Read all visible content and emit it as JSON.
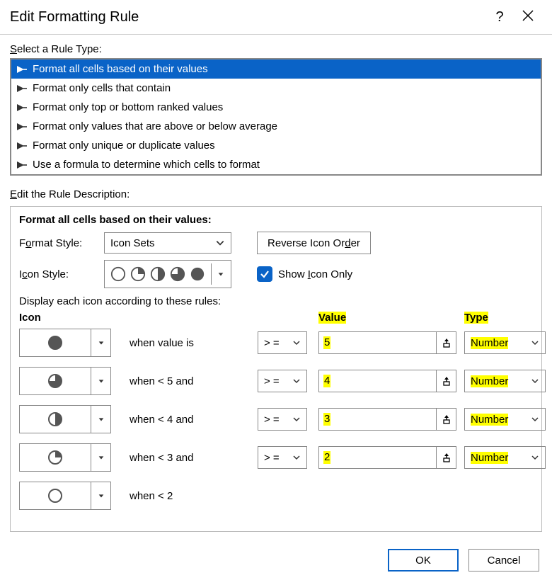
{
  "title": "Edit Formatting Rule",
  "select_label": "Select a Rule Type:",
  "rule_types": [
    "Format all cells based on their values",
    "Format only cells that contain",
    "Format only top or bottom ranked values",
    "Format only values that are above or below average",
    "Format only unique or duplicate values",
    "Use a formula to determine which cells to format"
  ],
  "edit_label": "Edit the Rule Description:",
  "section_title": "Format all cells based on their values:",
  "format_style_label": "Format Style:",
  "format_style_value": "Icon Sets",
  "reverse_btn": "Reverse Icon Order",
  "icon_style_label": "Icon Style:",
  "show_icon_only": "Show Icon Only",
  "display_label": "Display each icon according to these rules:",
  "col_icon": "Icon",
  "col_value": "Value",
  "col_type": "Type",
  "rules": [
    {
      "when": "when value is",
      "op": "> =",
      "value": "5",
      "type": "Number",
      "fill": 4
    },
    {
      "when": "when < 5 and",
      "op": "> =",
      "value": "4",
      "type": "Number",
      "fill": 3
    },
    {
      "when": "when < 4 and",
      "op": "> =",
      "value": "3",
      "type": "Number",
      "fill": 2
    },
    {
      "when": "when < 3 and",
      "op": "> =",
      "value": "2",
      "type": "Number",
      "fill": 1
    },
    {
      "when": "when < 2",
      "op": "",
      "value": "",
      "type": "",
      "fill": 0
    }
  ],
  "ok": "OK",
  "cancel": "Cancel",
  "help": "?"
}
